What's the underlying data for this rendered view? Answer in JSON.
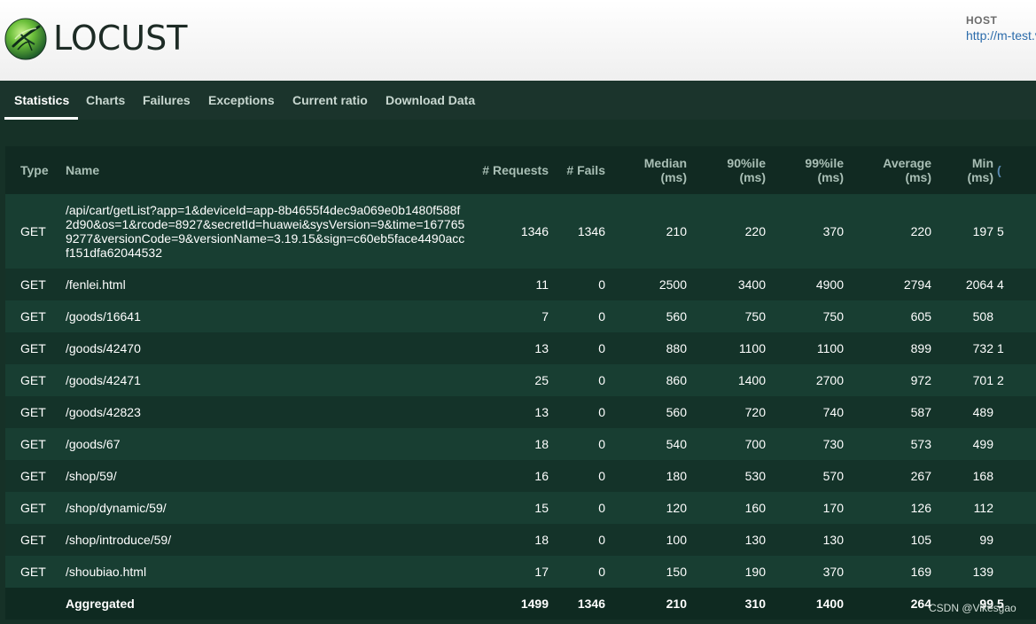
{
  "header": {
    "logo_text": "LOCUST",
    "logo_icon": "locust-logo-icon",
    "host_label": "HOST",
    "host_url": "http://m-test.v"
  },
  "tabs": [
    {
      "label": "Statistics",
      "active": true
    },
    {
      "label": "Charts",
      "active": false
    },
    {
      "label": "Failures",
      "active": false
    },
    {
      "label": "Exceptions",
      "active": false
    },
    {
      "label": "Current ratio",
      "active": false
    },
    {
      "label": "Download Data",
      "active": false
    }
  ],
  "table": {
    "columns": {
      "type": "Type",
      "name": "Name",
      "requests": "# Requests",
      "fails": "# Fails",
      "median": [
        "Median",
        "(ms)"
      ],
      "p90": [
        "90%ile",
        "(ms)"
      ],
      "p99": [
        "99%ile",
        "(ms)"
      ],
      "average": [
        "Average",
        "(ms)"
      ],
      "min": [
        "Min",
        "(ms)"
      ],
      "extra_partial": "("
    },
    "rows": [
      {
        "type": "GET",
        "name": "/api/cart/getList?app=1&deviceId=app-8b4655f4dec9a069e0b1480f588f2d90&os=1&rcode=8927&secretId=huawei&sysVersion=9&time=1677659277&versionCode=9&versionName=3.19.15&sign=c60eb5face4490accf151dfa62044532",
        "requests": "1346",
        "fails": "1346",
        "median": "210",
        "p90": "220",
        "p99": "370",
        "average": "220",
        "min": "197",
        "extra": "5"
      },
      {
        "type": "GET",
        "name": "/fenlei.html",
        "requests": "11",
        "fails": "0",
        "median": "2500",
        "p90": "3400",
        "p99": "4900",
        "average": "2794",
        "min": "2064",
        "extra": "4"
      },
      {
        "type": "GET",
        "name": "/goods/16641",
        "requests": "7",
        "fails": "0",
        "median": "560",
        "p90": "750",
        "p99": "750",
        "average": "605",
        "min": "508",
        "extra": ""
      },
      {
        "type": "GET",
        "name": "/goods/42470",
        "requests": "13",
        "fails": "0",
        "median": "880",
        "p90": "1100",
        "p99": "1100",
        "average": "899",
        "min": "732",
        "extra": "1"
      },
      {
        "type": "GET",
        "name": "/goods/42471",
        "requests": "25",
        "fails": "0",
        "median": "860",
        "p90": "1400",
        "p99": "2700",
        "average": "972",
        "min": "701",
        "extra": "2"
      },
      {
        "type": "GET",
        "name": "/goods/42823",
        "requests": "13",
        "fails": "0",
        "median": "560",
        "p90": "720",
        "p99": "740",
        "average": "587",
        "min": "489",
        "extra": ""
      },
      {
        "type": "GET",
        "name": "/goods/67",
        "requests": "18",
        "fails": "0",
        "median": "540",
        "p90": "700",
        "p99": "730",
        "average": "573",
        "min": "499",
        "extra": ""
      },
      {
        "type": "GET",
        "name": "/shop/59/",
        "requests": "16",
        "fails": "0",
        "median": "180",
        "p90": "530",
        "p99": "570",
        "average": "267",
        "min": "168",
        "extra": ""
      },
      {
        "type": "GET",
        "name": "/shop/dynamic/59/",
        "requests": "15",
        "fails": "0",
        "median": "120",
        "p90": "160",
        "p99": "170",
        "average": "126",
        "min": "112",
        "extra": ""
      },
      {
        "type": "GET",
        "name": "/shop/introduce/59/",
        "requests": "18",
        "fails": "0",
        "median": "100",
        "p90": "130",
        "p99": "130",
        "average": "105",
        "min": "99",
        "extra": ""
      },
      {
        "type": "GET",
        "name": "/shoubiao.html",
        "requests": "17",
        "fails": "0",
        "median": "150",
        "p90": "190",
        "p99": "370",
        "average": "169",
        "min": "139",
        "extra": ""
      }
    ],
    "aggregated": {
      "type": "",
      "name": "Aggregated",
      "requests": "1499",
      "fails": "1346",
      "median": "210",
      "p90": "310",
      "p99": "1400",
      "average": "264",
      "min": "99",
      "extra": "5"
    }
  },
  "watermark": "CSDN @Vikesgao",
  "colors": {
    "page_bg": "#163127",
    "tab_bar_bg": "#1b342c",
    "header_row_bg": "#112a22",
    "row_odd_bg": "#183e32",
    "row_even_bg": "#143329",
    "aggregated_bg": "#0f2a21",
    "host_link": "#2c6cab"
  }
}
